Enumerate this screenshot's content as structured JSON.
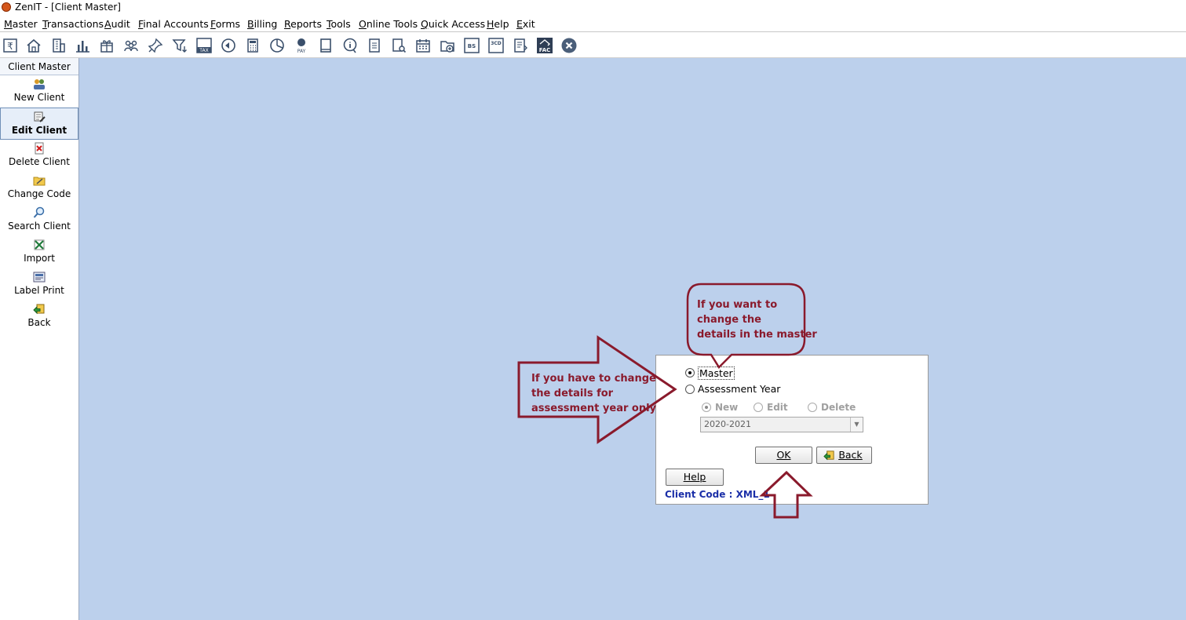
{
  "window": {
    "title": "ZenIT - [Client Master]"
  },
  "menu": [
    "Master",
    "Transactions",
    "Audit",
    "Final Accounts",
    "Forms",
    "Billing",
    "Reports",
    "Tools",
    "Online Tools",
    "Quick Access",
    "Help",
    "Exit"
  ],
  "toolbar": {
    "icons": [
      "rupee-icon",
      "home-icon",
      "buildings-icon",
      "bar-chart-icon",
      "gift-icon",
      "users-icon",
      "pin-icon",
      "filter-icon",
      "tax-icon",
      "refresh-icon",
      "calculator-icon",
      "pie-chart-icon",
      "pay-icon",
      "book-icon",
      "info-icon",
      "report-icon",
      "search-doc-icon",
      "calendar-icon",
      "add-folder-icon",
      "bs-icon",
      "3cd-icon",
      "ledger-icon",
      "fac-icon",
      "close-icon"
    ],
    "tax_label": "TAX",
    "pay_label": "PAY",
    "bs_label": "BS",
    "cd_label": "3CD",
    "fac_label": "FAC"
  },
  "sidebar": {
    "header": "Client Master",
    "items": [
      {
        "label": "New Client",
        "icon": "new-client-icon"
      },
      {
        "label": "Edit Client",
        "icon": "edit-client-icon",
        "active": true
      },
      {
        "label": "Delete Client",
        "icon": "delete-client-icon"
      },
      {
        "label": "Change Code",
        "icon": "change-code-icon"
      },
      {
        "label": "Search Client",
        "icon": "search-client-icon"
      },
      {
        "label": "Import",
        "icon": "import-icon"
      },
      {
        "label": "Label Print",
        "icon": "label-print-icon"
      },
      {
        "label": "Back",
        "icon": "back-icon"
      }
    ]
  },
  "dialog": {
    "master_label": "Master",
    "assessment_year_label": "Assessment Year",
    "new_label": "New",
    "edit_label": "Edit",
    "delete_label": "Delete",
    "year_value": "2020-2021",
    "ok_label": "OK",
    "back_label": "Back",
    "help_label": "Help",
    "client_code": "Client Code : XML_1"
  },
  "annotations": {
    "callout_lines": [
      "If you want to",
      "change the",
      "details in the  master"
    ],
    "arrow_lines": [
      "If you have to change",
      "the details for",
      "assessment year only"
    ],
    "color": "#8a1a2c"
  }
}
